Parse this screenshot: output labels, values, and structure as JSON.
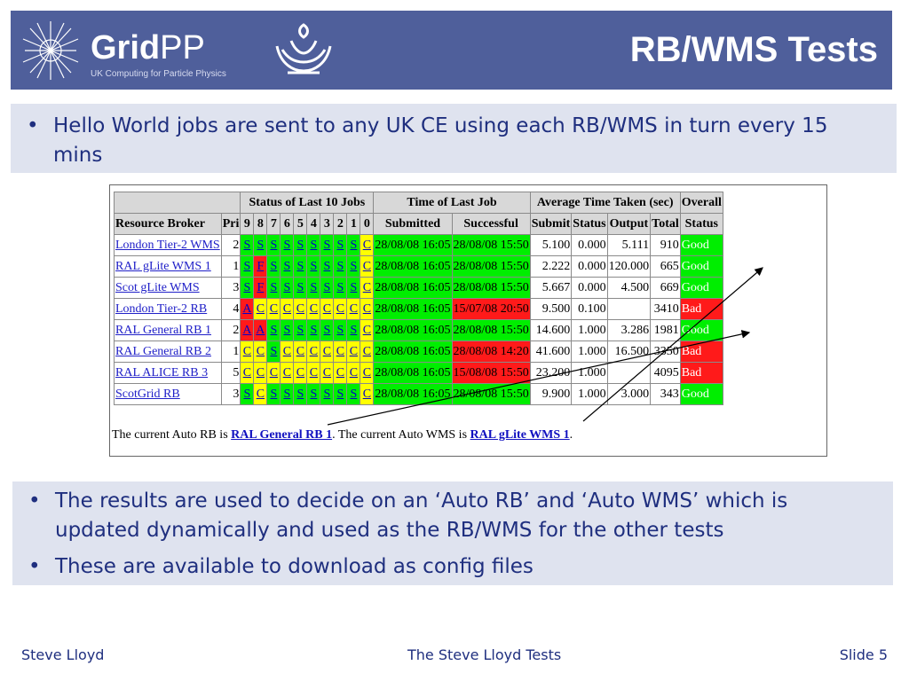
{
  "header": {
    "logo_main_bold": "Grid",
    "logo_main_light": "PP",
    "logo_sub": "UK Computing for Particle Physics",
    "title": "RB/WMS Tests"
  },
  "intro": {
    "bullet": "•",
    "text": "Hello World jobs are sent to any UK CE using each RB/WMS in turn every 15 mins"
  },
  "table": {
    "group_headers": {
      "status": "Status of Last 10 Jobs",
      "time": "Time of Last Job",
      "avg": "Average Time Taken (sec)",
      "overall": "Overall"
    },
    "col_headers": {
      "rb": "Resource Broker",
      "pri": "Pri",
      "slots": [
        "9",
        "8",
        "7",
        "6",
        "5",
        "4",
        "3",
        "2",
        "1",
        "0"
      ],
      "submitted": "Submitted",
      "successful": "Successful",
      "submit": "Submit",
      "status": "Status",
      "output": "Output",
      "total": "Total",
      "overall_status": "Status"
    },
    "rows": [
      {
        "name": "London Tier-2 WMS",
        "pri": "2",
        "jobs": [
          "S",
          "S",
          "S",
          "S",
          "S",
          "S",
          "S",
          "S",
          "S",
          "C"
        ],
        "colors": [
          "g",
          "g",
          "g",
          "g",
          "g",
          "g",
          "g",
          "g",
          "g",
          "y"
        ],
        "submitted": "28/08/08 16:05",
        "successful": "28/08/08 15:50",
        "succ_color": "g",
        "submit": "5.100",
        "status": "0.000",
        "output": "5.111",
        "total": "910",
        "overall": "Good"
      },
      {
        "name": "RAL gLite WMS 1",
        "pri": "1",
        "jobs": [
          "S",
          "F",
          "S",
          "S",
          "S",
          "S",
          "S",
          "S",
          "S",
          "C"
        ],
        "colors": [
          "g",
          "r",
          "g",
          "g",
          "g",
          "g",
          "g",
          "g",
          "g",
          "y"
        ],
        "submitted": "28/08/08 16:05",
        "successful": "28/08/08 15:50",
        "succ_color": "g",
        "submit": "2.222",
        "status": "0.000",
        "output": "120.000",
        "total": "665",
        "overall": "Good"
      },
      {
        "name": "Scot gLite WMS",
        "pri": "3",
        "jobs": [
          "S",
          "F",
          "S",
          "S",
          "S",
          "S",
          "S",
          "S",
          "S",
          "C"
        ],
        "colors": [
          "g",
          "r",
          "g",
          "g",
          "g",
          "g",
          "g",
          "g",
          "g",
          "y"
        ],
        "submitted": "28/08/08 16:05",
        "successful": "28/08/08 15:50",
        "succ_color": "g",
        "submit": "5.667",
        "status": "0.000",
        "output": "4.500",
        "total": "669",
        "overall": "Good"
      },
      {
        "name": "London Tier-2 RB",
        "pri": "4",
        "jobs": [
          "A",
          "C",
          "C",
          "C",
          "C",
          "C",
          "C",
          "C",
          "C",
          "C"
        ],
        "colors": [
          "r",
          "y",
          "y",
          "y",
          "y",
          "y",
          "y",
          "y",
          "y",
          "y"
        ],
        "submitted": "28/08/08 16:05",
        "successful": "15/07/08 20:50",
        "succ_color": "r",
        "submit": "9.500",
        "status": "0.100",
        "output": "",
        "total": "3410",
        "overall": "Bad"
      },
      {
        "name": "RAL General RB 1",
        "pri": "2",
        "jobs": [
          "A",
          "A",
          "S",
          "S",
          "S",
          "S",
          "S",
          "S",
          "S",
          "C"
        ],
        "colors": [
          "r",
          "r",
          "g",
          "g",
          "g",
          "g",
          "g",
          "g",
          "g",
          "y"
        ],
        "submitted": "28/08/08 16:05",
        "successful": "28/08/08 15:50",
        "succ_color": "g",
        "submit": "14.600",
        "status": "1.000",
        "output": "3.286",
        "total": "1981",
        "overall": "Good"
      },
      {
        "name": "RAL General RB 2",
        "pri": "1",
        "jobs": [
          "C",
          "C",
          "S",
          "C",
          "C",
          "C",
          "C",
          "C",
          "C",
          "C"
        ],
        "colors": [
          "y",
          "y",
          "g",
          "y",
          "y",
          "y",
          "y",
          "y",
          "y",
          "y"
        ],
        "submitted": "28/08/08 16:05",
        "successful": "28/08/08 14:20",
        "succ_color": "r",
        "submit": "41.600",
        "status": "1.000",
        "output": "16.500",
        "total": "3350",
        "overall": "Bad"
      },
      {
        "name": "RAL ALICE RB 3",
        "pri": "5",
        "jobs": [
          "C",
          "C",
          "C",
          "C",
          "C",
          "C",
          "C",
          "C",
          "C",
          "C"
        ],
        "colors": [
          "y",
          "y",
          "y",
          "y",
          "y",
          "y",
          "y",
          "y",
          "y",
          "y"
        ],
        "submitted": "28/08/08 16:05",
        "successful": "15/08/08 15:50",
        "succ_color": "r",
        "submit": "23.200",
        "status": "1.000",
        "output": "",
        "total": "4095",
        "overall": "Bad"
      },
      {
        "name": "ScotGrid RB",
        "pri": "3",
        "jobs": [
          "S",
          "C",
          "S",
          "S",
          "S",
          "S",
          "S",
          "S",
          "S",
          "C"
        ],
        "colors": [
          "g",
          "y",
          "g",
          "g",
          "g",
          "g",
          "g",
          "g",
          "g",
          "y"
        ],
        "submitted": "28/08/08 16:05",
        "successful": "28/08/08 15:50",
        "succ_color": "g",
        "submit": "9.900",
        "status": "1.000",
        "output": "3.000",
        "total": "343",
        "overall": "Good"
      }
    ],
    "footer_prefix": "The current Auto RB is ",
    "auto_rb": "RAL General RB 1",
    "footer_middle": ". The current Auto WMS is ",
    "auto_wms": "RAL gLite WMS 1",
    "footer_suffix": "."
  },
  "results": {
    "bullet": "•",
    "items": [
      "The results are used to decide on an ‘Auto RB’ and ‘Auto WMS’ which is updated dynamically and used as the RB/WMS for the other tests",
      "These are available to download as config files"
    ]
  },
  "footer": {
    "author": "Steve Lloyd",
    "center": "The Steve Lloyd Tests",
    "slide": "Slide 5"
  },
  "colors": {
    "header_bg": "#4f5f9b",
    "box_bg": "#dfe3ef",
    "text_blue": "#1f2f7f",
    "good_green": "#00ee00",
    "bad_red": "#ff1a1a",
    "pending_yellow": "#ffff00"
  }
}
